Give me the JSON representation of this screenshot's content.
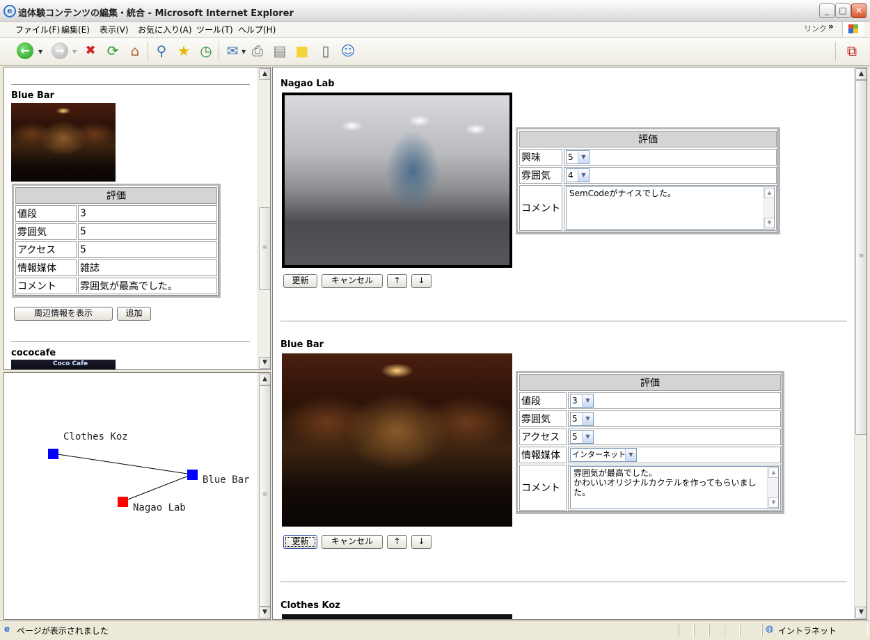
{
  "window": {
    "title": "追体験コンテンツの編集・統合 - Microsoft Internet Explorer",
    "controls": {
      "minimize": "_",
      "maximize": "□",
      "close": "✕"
    }
  },
  "menu": {
    "items": [
      "ファイル(F)",
      "編集(E)",
      "表示(V)",
      "お気に入り(A)",
      "ツール(T)",
      "ヘルプ(H)"
    ],
    "links_label": "リンク",
    "links_chevron": "»"
  },
  "toolbar": {
    "icons": [
      "back-icon",
      "forward-icon",
      "stop-icon",
      "refresh-icon",
      "home-icon",
      "search-icon",
      "favorites-icon",
      "history-icon",
      "mail-icon",
      "print-icon",
      "edit-icon",
      "discuss-icon",
      "messenger-icon",
      "contacts-icon",
      "pdf-icon"
    ]
  },
  "left_list": {
    "entries": [
      {
        "title": "Blue Bar",
        "eval_header": "評価",
        "rows": [
          {
            "label": "値段",
            "value": "3"
          },
          {
            "label": "雰囲気",
            "value": "5"
          },
          {
            "label": "アクセス",
            "value": "5"
          },
          {
            "label": "情報媒体",
            "value": "雑誌"
          },
          {
            "label": "コメント",
            "value": "雰囲気が最高でした。"
          }
        ],
        "show_nearby_button": "周辺情報を表示",
        "add_button": "追加"
      },
      {
        "title": "cococafe",
        "photo_caption": "Coco Cafe"
      }
    ]
  },
  "map": {
    "nodes": [
      {
        "name": "Clothes Koz",
        "color": "#0000ff"
      },
      {
        "name": "Blue Bar",
        "color": "#0000ff"
      },
      {
        "name": "Nagao Lab",
        "color": "#ff0000"
      }
    ]
  },
  "main": {
    "entries": [
      {
        "title": "Nagao Lab",
        "eval_header": "評価",
        "rows": [
          {
            "label": "興味",
            "type": "select",
            "value": "5"
          },
          {
            "label": "雰囲気",
            "type": "select",
            "value": "4"
          },
          {
            "label": "コメント",
            "type": "textarea",
            "value": "SemCodeがナイスでした。"
          }
        ],
        "buttons": {
          "update": "更新",
          "cancel": "キャンセル",
          "up": "↑",
          "down": "↓"
        }
      },
      {
        "title": "Blue Bar",
        "eval_header": "評価",
        "rows": [
          {
            "label": "値段",
            "type": "select",
            "value": "3"
          },
          {
            "label": "雰囲気",
            "type": "select",
            "value": "5"
          },
          {
            "label": "アクセス",
            "type": "select",
            "value": "5"
          },
          {
            "label": "情報媒体",
            "type": "select",
            "value": "インターネット"
          },
          {
            "label": "コメント",
            "type": "textarea",
            "value": "雰囲気が最高でした。\nかわいいオリジナルカクテルを作ってもらいました。"
          }
        ],
        "buttons": {
          "update": "更新",
          "cancel": "キャンセル",
          "up": "↑",
          "down": "↓"
        }
      },
      {
        "title": "Clothes Koz"
      }
    ]
  },
  "status": {
    "message": "ページが表示されました",
    "zone": "イントラネット"
  }
}
